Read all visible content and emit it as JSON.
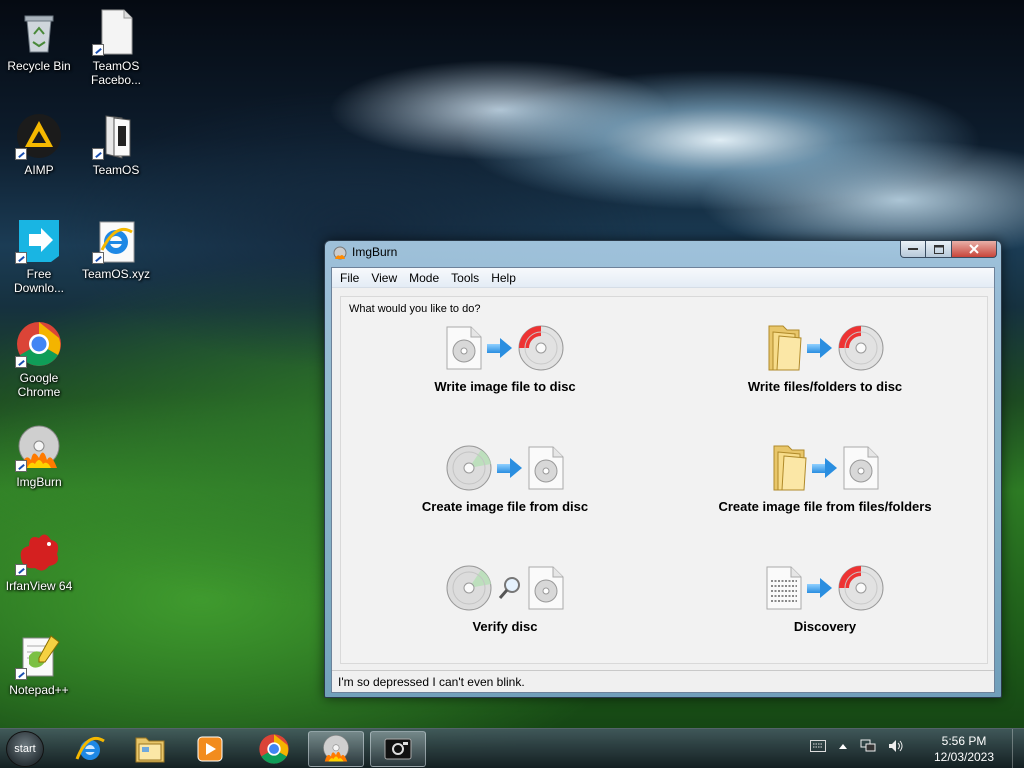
{
  "desktop": {
    "icons": [
      {
        "label": "Recycle Bin"
      },
      {
        "label": "TeamOS\nFacebo..."
      },
      {
        "label": "AIMP"
      },
      {
        "label": "TeamOS"
      },
      {
        "label": "Free\nDownlo..."
      },
      {
        "label": "TeamOS.xyz"
      },
      {
        "label": "Google\nChrome"
      },
      {
        "label": "ImgBurn"
      },
      {
        "label": "IrfanView 64"
      },
      {
        "label": "Notepad++"
      }
    ]
  },
  "window": {
    "title": "ImgBurn",
    "menu": [
      "File",
      "View",
      "Mode",
      "Tools",
      "Help"
    ],
    "prompt": "What would you like to do?",
    "modes": [
      {
        "label": "Write image file to disc"
      },
      {
        "label": "Write files/folders to disc"
      },
      {
        "label": "Create image file from disc"
      },
      {
        "label": "Create image file from files/folders"
      },
      {
        "label": "Verify disc"
      },
      {
        "label": "Discovery"
      }
    ],
    "status": "I'm so depressed I can't even blink."
  },
  "taskbar": {
    "start_label": "start",
    "clock_time": "5:56 PM",
    "clock_date": "12/03/2023"
  }
}
